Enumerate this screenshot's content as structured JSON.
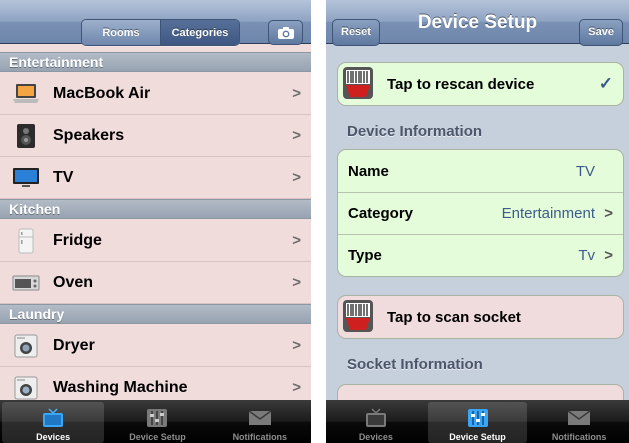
{
  "left": {
    "segments": [
      "Rooms",
      "Categories"
    ],
    "selected_segment": "Categories",
    "sections": [
      {
        "title": "Entertainment",
        "items": [
          {
            "label": "MacBook Air",
            "icon": "laptop-icon"
          },
          {
            "label": "Speakers",
            "icon": "speaker-icon"
          },
          {
            "label": "TV",
            "icon": "tv-icon"
          }
        ]
      },
      {
        "title": "Kitchen",
        "items": [
          {
            "label": "Fridge",
            "icon": "fridge-icon"
          },
          {
            "label": "Oven",
            "icon": "oven-icon"
          }
        ]
      },
      {
        "title": "Laundry",
        "items": [
          {
            "label": "Dryer",
            "icon": "dryer-icon"
          },
          {
            "label": "Washing Machine",
            "icon": "washing-machine-icon"
          }
        ]
      }
    ],
    "chevron": ">",
    "tabs": [
      "Devices",
      "Device Setup",
      "Notifications"
    ],
    "selected_tab": "Devices"
  },
  "right": {
    "title": "Device Setup",
    "reset": "Reset",
    "save": "Save",
    "rescan": "Tap to rescan device",
    "check": "✓",
    "device_info_header": "Device Information",
    "fields": [
      {
        "label": "Name",
        "value": "TV"
      },
      {
        "label": "Category",
        "value": "Entertainment",
        "chevron": ">"
      },
      {
        "label": "Type",
        "value": "Tv",
        "chevron": ">"
      }
    ],
    "scan_socket": "Tap to scan socket",
    "socket_info_header": "Socket Information",
    "tabs": [
      "Devices",
      "Device Setup",
      "Notifications"
    ],
    "selected_tab": "Device Setup"
  },
  "colors": {
    "list_background": "#f1dcdc",
    "grouped_background": "#c6cfdc",
    "green_cell": "#e4fcd9",
    "value_text": "#3d5c8c"
  }
}
